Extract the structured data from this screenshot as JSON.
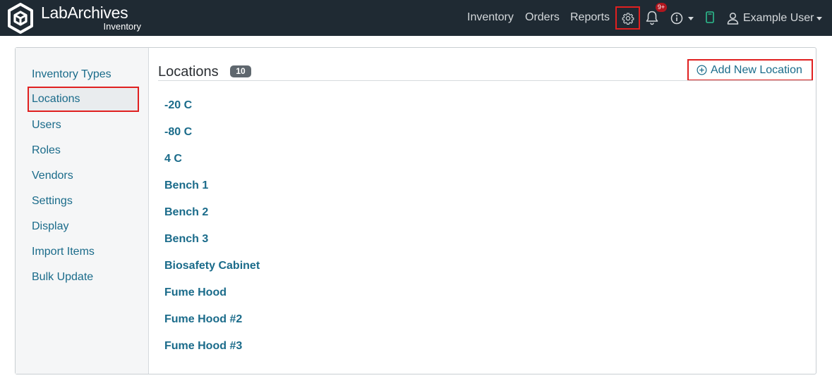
{
  "app": {
    "brand_name": "LabArchives",
    "brand_sub": "Inventory"
  },
  "nav": {
    "links": [
      "Inventory",
      "Orders",
      "Reports"
    ],
    "notification_badge": "9+",
    "user_name": "Example User"
  },
  "sidebar": {
    "items": [
      {
        "label": "Inventory Types",
        "active": false
      },
      {
        "label": "Locations",
        "active": true
      },
      {
        "label": "Users",
        "active": false
      },
      {
        "label": "Roles",
        "active": false
      },
      {
        "label": "Vendors",
        "active": false
      },
      {
        "label": "Settings",
        "active": false
      },
      {
        "label": "Display",
        "active": false
      },
      {
        "label": "Import Items",
        "active": false
      },
      {
        "label": "Bulk Update",
        "active": false
      }
    ]
  },
  "main": {
    "title": "Locations",
    "count": "10",
    "add_button_label": "Add New Location",
    "locations": [
      "-20 C",
      "-80 C",
      "4 C",
      "Bench 1",
      "Bench 2",
      "Bench 3",
      "Biosafety Cabinet",
      "Fume Hood",
      "Fume Hood #2",
      "Fume Hood #3"
    ]
  },
  "colors": {
    "topbar": "#1f2a33",
    "link": "#1a6b8a",
    "highlight": "#e02020",
    "badge": "#b0161e"
  }
}
